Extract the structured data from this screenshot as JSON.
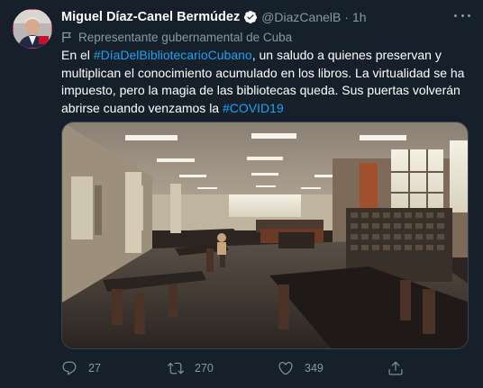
{
  "tweet": {
    "author_name": "Miguel Díaz-Canel Bermúdez",
    "author_handle": "@DiazCanelB",
    "separator": "·",
    "time": "1h",
    "label": "Representante gubernamental de Cuba",
    "text_parts": [
      {
        "kind": "text",
        "value": "En el "
      },
      {
        "kind": "hashtag",
        "value": "#DíaDelBibliotecarioCubano"
      },
      {
        "kind": "text",
        "value": ", un saludo a quienes preservan y multiplican el conocimiento acumulado en los libros. La virtualidad se ha impuesto, pero la magia de las bibliotecas queda. Sus puertas volverán abrirse cuando venzamos la "
      },
      {
        "kind": "hashtag",
        "value": "#COVID19"
      }
    ],
    "actions": {
      "reply_count": "27",
      "retweet_count": "270",
      "like_count": "349",
      "share_count": ""
    }
  },
  "icons": {
    "verified": "verified-badge-icon",
    "label": "flag-icon",
    "reply": "reply-icon",
    "retweet": "retweet-icon",
    "like": "heart-icon",
    "share": "share-icon",
    "more": "more-icon"
  },
  "colors": {
    "background": "#15202b",
    "accent": "#1da1f2",
    "muted": "#8899a6",
    "border": "#38444d"
  }
}
